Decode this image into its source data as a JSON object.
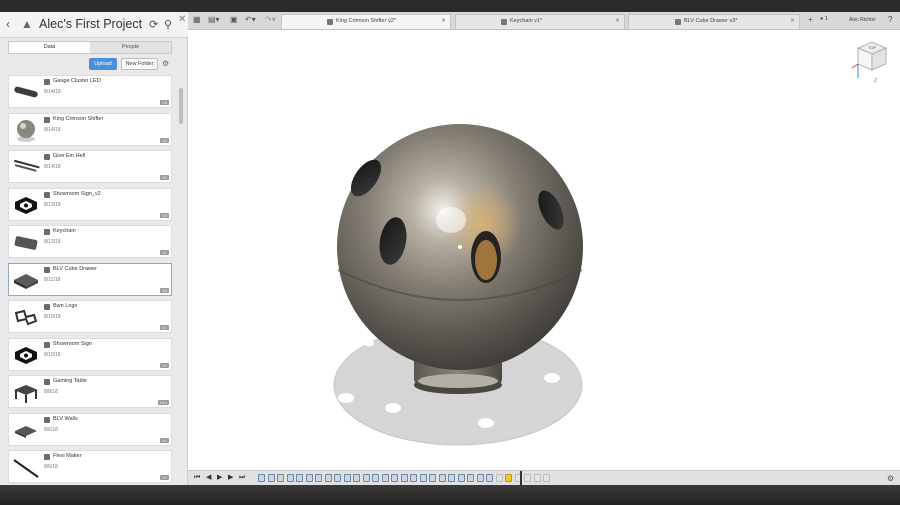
{
  "panel": {
    "title": "Alec's First Project",
    "tabs": [
      "Data",
      "People"
    ],
    "upload_label": "Upload",
    "new_folder_label": "New Folder",
    "items": [
      {
        "name": "Gauge Cluster LED",
        "date": "8/14/18",
        "version": "V3",
        "thumb": "bar"
      },
      {
        "name": "King Crimson Shifter",
        "date": "8/14/18",
        "version": "V2",
        "thumb": "sphere"
      },
      {
        "name": "Give Em Hell",
        "date": "8/14/18",
        "version": "V1",
        "thumb": "text"
      },
      {
        "name": "Showroom Sign_v2",
        "date": "8/13/18",
        "version": "V3",
        "thumb": "hex"
      },
      {
        "name": "Keychain",
        "date": "8/13/18",
        "version": "V1",
        "thumb": "plate"
      },
      {
        "name": "BLV Cube Drawer",
        "date": "8/11/18",
        "version": "V3",
        "thumb": "drawer"
      },
      {
        "name": "Bwn Logo",
        "date": "8/10/18",
        "version": "V1",
        "thumb": "logo"
      },
      {
        "name": "Showroom Sign",
        "date": "8/10/18",
        "version": "V1",
        "thumb": "hex"
      },
      {
        "name": "Gaming Table",
        "date": "8/8/18",
        "version": "V10",
        "thumb": "table"
      },
      {
        "name": "BLV Walls",
        "date": "8/6/18",
        "version": "V1",
        "thumb": "walls"
      },
      {
        "name": "Flexi Maker",
        "date": "8/6/18",
        "version": "V1",
        "thumb": "stick"
      }
    ]
  },
  "toolbar": {
    "tabs": [
      {
        "label": "King Crimson Shifter v2*",
        "active": true
      },
      {
        "label": "Keychain v1*",
        "active": false
      },
      {
        "label": "BLV Cube Drawer v3*",
        "active": false
      }
    ],
    "notification_count": "1",
    "user_name": "Alec Richter"
  },
  "viewcube": {
    "face": "TOP",
    "axis_z": "Z"
  }
}
